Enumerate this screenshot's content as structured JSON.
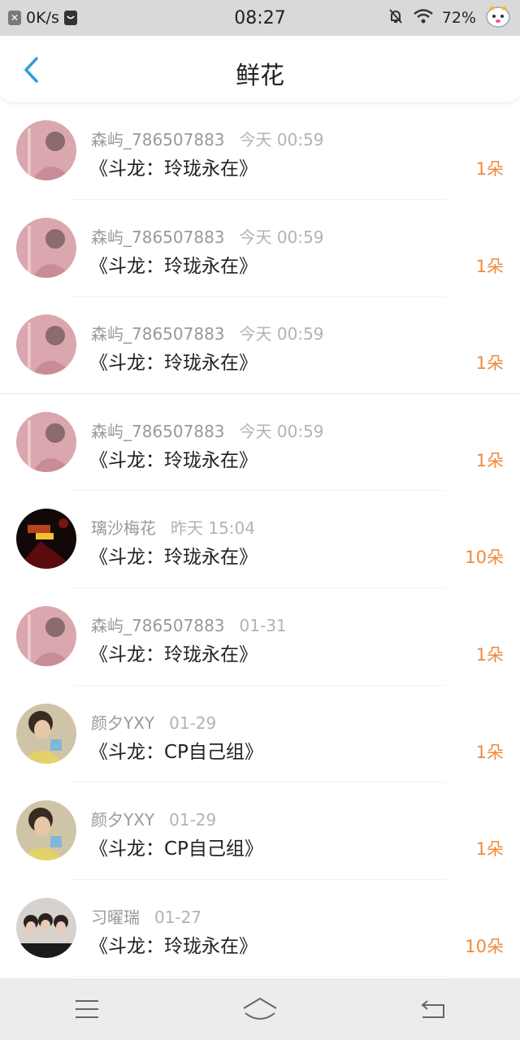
{
  "status": {
    "speed": "0K/s",
    "time": "08:27",
    "battery": "72%",
    "icons": [
      "close-badge-icon",
      "notification-icon",
      "mute-bell-icon",
      "wifi-icon",
      "mascot-icon"
    ]
  },
  "header": {
    "title": "鲜花",
    "back_icon": "chevron-left-icon"
  },
  "rows": [
    {
      "user": "森屿_786507883",
      "time": "今天 00:59",
      "book": "《斗龙：玲珑永在》",
      "count": "1朵",
      "avatar": "pink"
    },
    {
      "user": "森屿_786507883",
      "time": "今天 00:59",
      "book": "《斗龙：玲珑永在》",
      "count": "1朵",
      "avatar": "pink"
    },
    {
      "user": "森屿_786507883",
      "time": "今天 00:59",
      "book": "《斗龙：玲珑永在》",
      "count": "1朵",
      "avatar": "pink"
    },
    {
      "user": "森屿_786507883",
      "time": "今天 00:59",
      "book": "《斗龙：玲珑永在》",
      "count": "1朵",
      "avatar": "pink"
    },
    {
      "user": "璃沙梅花",
      "time": "昨天 15:04",
      "book": "《斗龙：玲珑永在》",
      "count": "10朵",
      "avatar": "dark"
    },
    {
      "user": "森屿_786507883",
      "time": "01-31",
      "book": "《斗龙：玲珑永在》",
      "count": "1朵",
      "avatar": "pink"
    },
    {
      "user": "颜夕YXY",
      "time": "01-29",
      "book": "《斗龙：CP自己组》",
      "count": "1朵",
      "avatar": "photo"
    },
    {
      "user": "颜夕YXY",
      "time": "01-29",
      "book": "《斗龙：CP自己组》",
      "count": "1朵",
      "avatar": "photo"
    },
    {
      "user": "习曜瑞",
      "time": "01-27",
      "book": "《斗龙：玲珑永在》",
      "count": "10朵",
      "avatar": "group"
    }
  ],
  "colors": {
    "accent": "#2f9de0",
    "count": "#f08a3a",
    "statusbar": "#d9d9d9",
    "navbar": "#ececec"
  },
  "navbar": {
    "icons": [
      "menu-icon",
      "home-icon",
      "back-icon"
    ]
  }
}
